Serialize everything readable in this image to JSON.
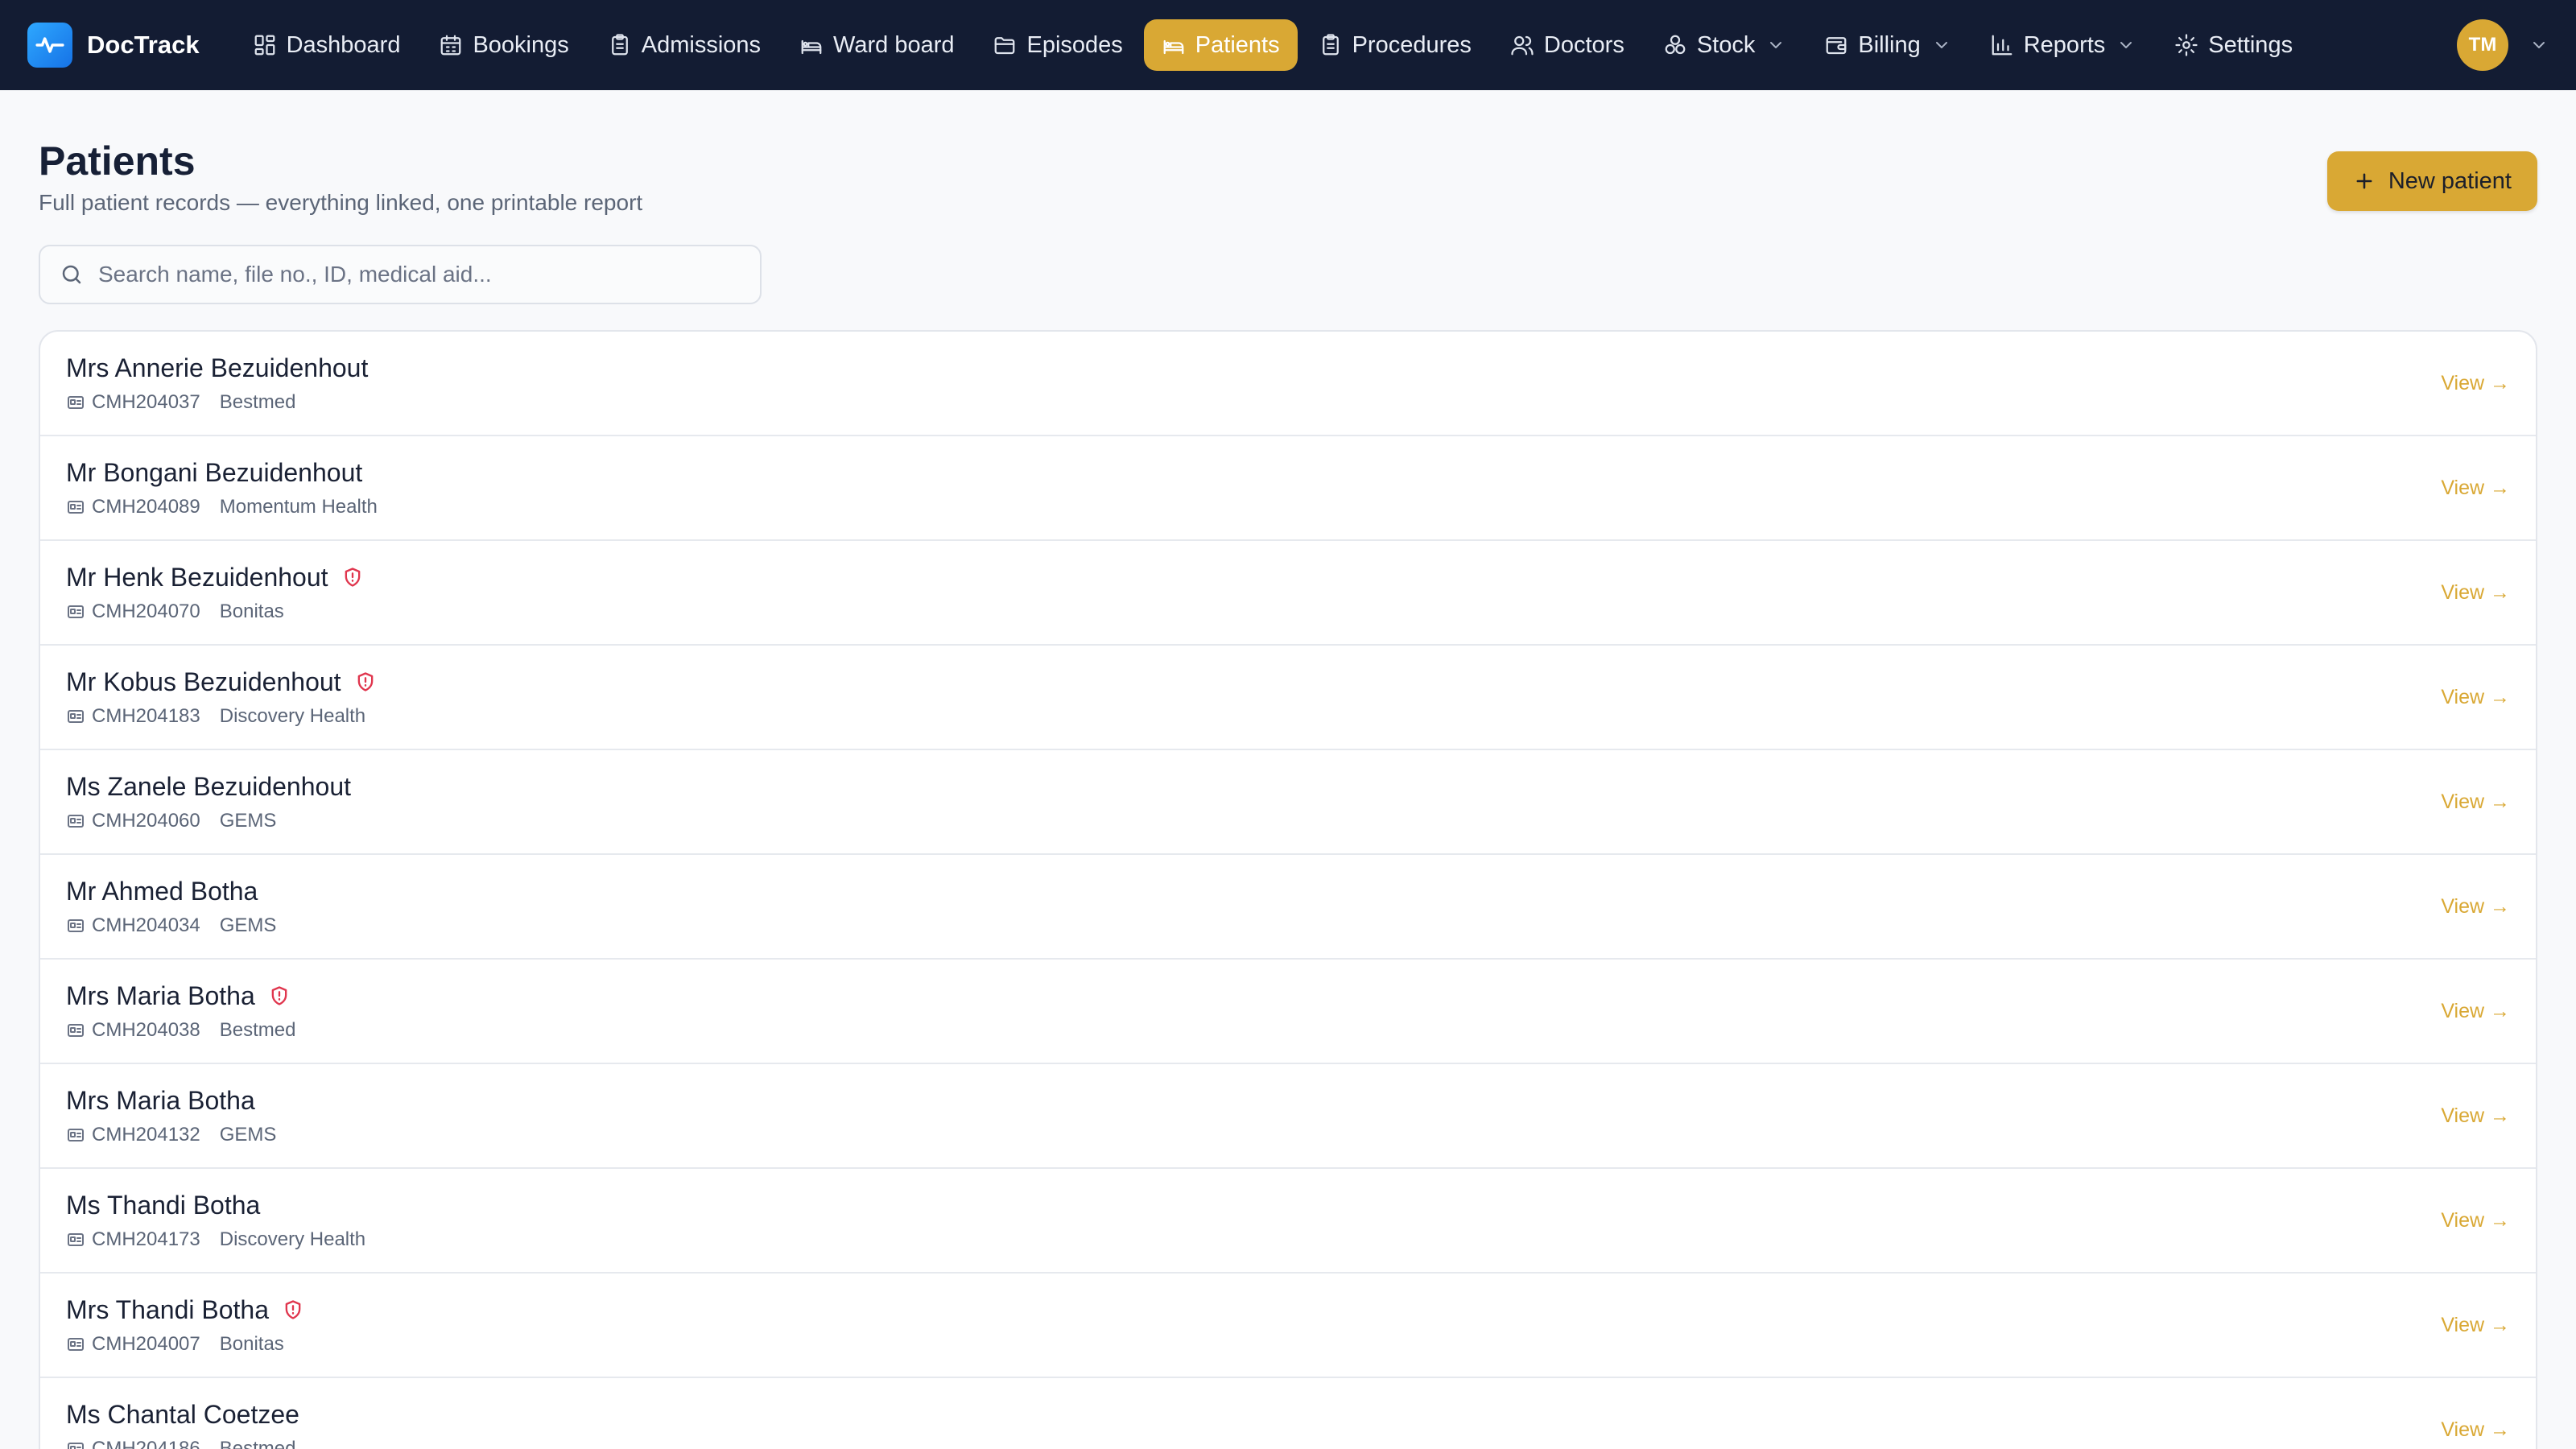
{
  "brand": {
    "name": "DocTrack"
  },
  "nav": {
    "items": [
      {
        "label": "Dashboard",
        "icon": "grid-icon",
        "active": false,
        "dropdown": false
      },
      {
        "label": "Bookings",
        "icon": "calendar-icon",
        "active": false,
        "dropdown": false
      },
      {
        "label": "Admissions",
        "icon": "clipboard-icon",
        "active": false,
        "dropdown": false
      },
      {
        "label": "Ward board",
        "icon": "bed-icon",
        "active": false,
        "dropdown": false
      },
      {
        "label": "Episodes",
        "icon": "folder-icon",
        "active": false,
        "dropdown": false
      },
      {
        "label": "Patients",
        "icon": "bed-icon",
        "active": true,
        "dropdown": false
      },
      {
        "label": "Procedures",
        "icon": "clipboard-icon",
        "active": false,
        "dropdown": false
      },
      {
        "label": "Doctors",
        "icon": "users-icon",
        "active": false,
        "dropdown": false
      },
      {
        "label": "Stock",
        "icon": "boxes-icon",
        "active": false,
        "dropdown": true
      },
      {
        "label": "Billing",
        "icon": "wallet-icon",
        "active": false,
        "dropdown": true
      },
      {
        "label": "Reports",
        "icon": "bar-chart-icon",
        "active": false,
        "dropdown": true
      },
      {
        "label": "Settings",
        "icon": "gear-icon",
        "active": false,
        "dropdown": false
      }
    ],
    "user_initials": "TM"
  },
  "page": {
    "title": "Patients",
    "subtitle": "Full patient records — everything linked, one printable report",
    "new_button_label": "New patient"
  },
  "search": {
    "placeholder": "Search name, file no., ID, medical aid...",
    "value": ""
  },
  "patients": [
    {
      "name": "Mrs Annerie Bezuidenhout",
      "file_no": "CMH204037",
      "medical_aid": "Bestmed",
      "flag": false,
      "action": "View →"
    },
    {
      "name": "Mr Bongani Bezuidenhout",
      "file_no": "CMH204089",
      "medical_aid": "Momentum Health",
      "flag": false,
      "action": "View →"
    },
    {
      "name": "Mr Henk Bezuidenhout",
      "file_no": "CMH204070",
      "medical_aid": "Bonitas",
      "flag": true,
      "action": "View →"
    },
    {
      "name": "Mr Kobus Bezuidenhout",
      "file_no": "CMH204183",
      "medical_aid": "Discovery Health",
      "flag": true,
      "action": "View →"
    },
    {
      "name": "Ms Zanele Bezuidenhout",
      "file_no": "CMH204060",
      "medical_aid": "GEMS",
      "flag": false,
      "action": "View →"
    },
    {
      "name": "Mr Ahmed Botha",
      "file_no": "CMH204034",
      "medical_aid": "GEMS",
      "flag": false,
      "action": "View →"
    },
    {
      "name": "Mrs Maria Botha",
      "file_no": "CMH204038",
      "medical_aid": "Bestmed",
      "flag": true,
      "action": "View →"
    },
    {
      "name": "Mrs Maria Botha",
      "file_no": "CMH204132",
      "medical_aid": "GEMS",
      "flag": false,
      "action": "View →"
    },
    {
      "name": "Ms Thandi Botha",
      "file_no": "CMH204173",
      "medical_aid": "Discovery Health",
      "flag": false,
      "action": "View →"
    },
    {
      "name": "Mrs Thandi Botha",
      "file_no": "CMH204007",
      "medical_aid": "Bonitas",
      "flag": true,
      "action": "View →"
    },
    {
      "name": "Ms Chantal Coetzee",
      "file_no": "CMH204186",
      "medical_aid": "Bestmed",
      "flag": false,
      "action": "View →"
    }
  ],
  "colors": {
    "nav_bg": "#131c33",
    "accent": "#d9a834",
    "flag": "#e0364e",
    "brand_logo": "#1e8cf2"
  }
}
